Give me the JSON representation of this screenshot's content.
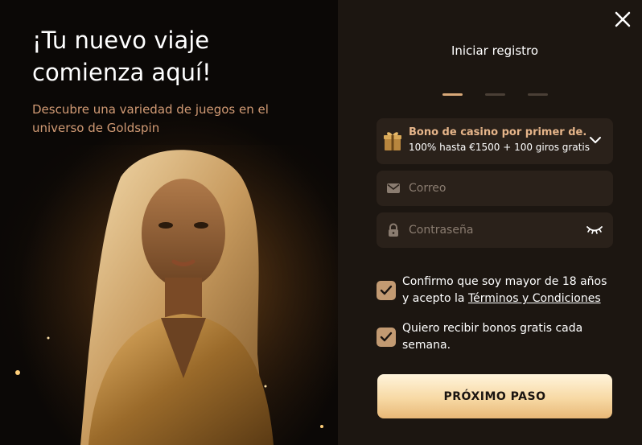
{
  "hero": {
    "title_line1": "¡Tu nuevo viaje",
    "title_line2": "comienza aquí!",
    "subtitle": "Descubre una variedad de juegos en el universo de Goldspin",
    "image_icon": "woman-portrait-image"
  },
  "panel": {
    "title": "Iniciar registro",
    "steps": [
      {
        "active": true
      },
      {
        "active": false
      },
      {
        "active": false
      }
    ],
    "close_icon": "close-icon"
  },
  "bonus": {
    "title": "Bono de casino por primer de...",
    "description": "100% hasta €1500 + 100 giros gratis",
    "icon": "gift-icon"
  },
  "form": {
    "email_placeholder": "Correo",
    "password_placeholder": "Contraseña"
  },
  "checks": {
    "age_text": "Confirmo que soy mayor de 18 años y acepto la",
    "terms_link": "Términos y Condiciones",
    "bonus_text": "Quiero recibir bonos gratis cada semana."
  },
  "cta": {
    "label": "PRÓXIMO PASO"
  },
  "colors": {
    "accent": "#c29a72",
    "panel": "#1c1611",
    "field": "#2a211a",
    "subtitle": "#d19a74"
  }
}
